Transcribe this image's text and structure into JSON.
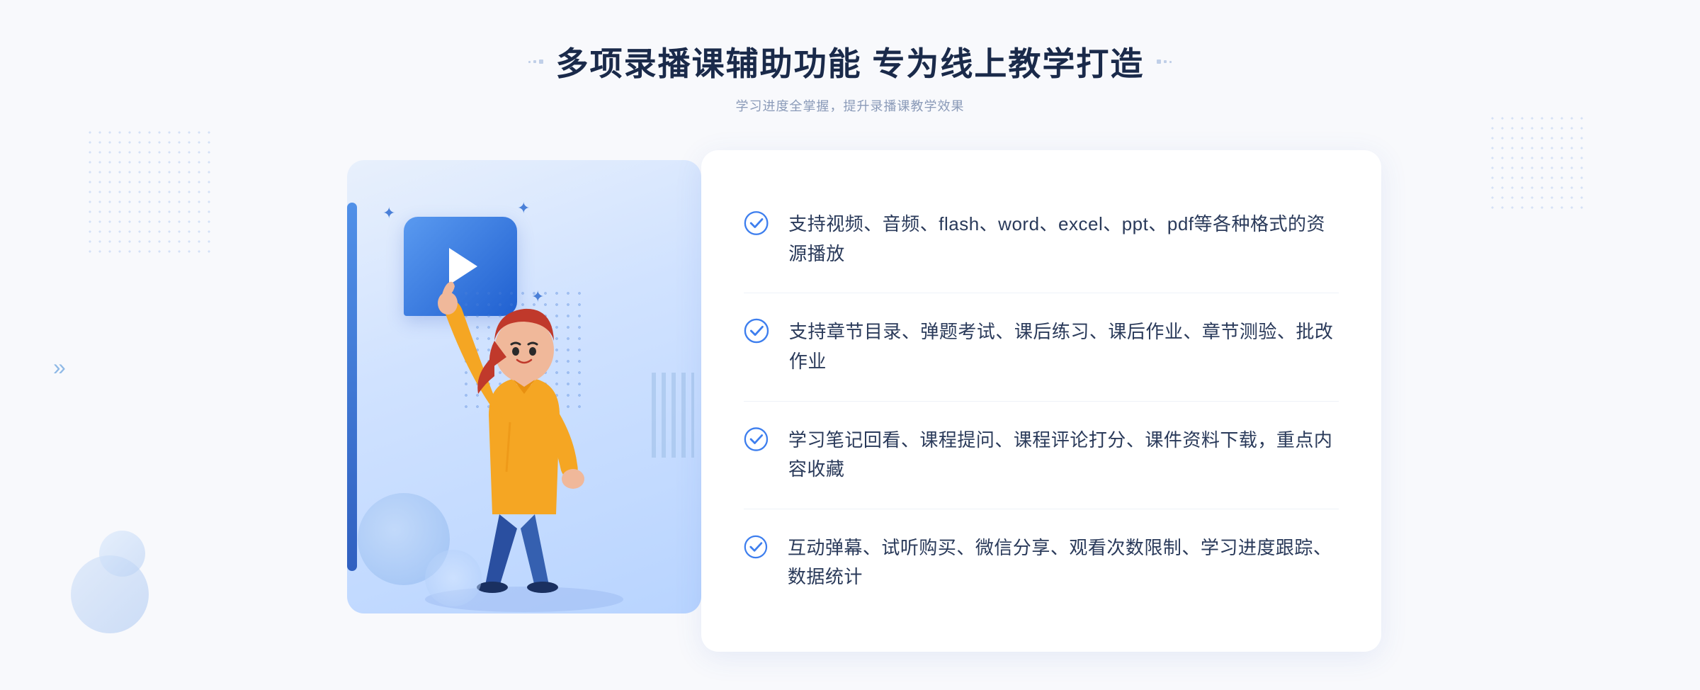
{
  "header": {
    "title": "多项录播课辅助功能 专为线上教学打造",
    "subtitle": "学习进度全掌握，提升录播课教学效果",
    "deco_left": "❋ ❋",
    "deco_right": "❋ ❋"
  },
  "features": [
    {
      "id": 1,
      "text": "支持视频、音频、flash、word、excel、ppt、pdf等各种格式的资源播放"
    },
    {
      "id": 2,
      "text": "支持章节目录、弹题考试、课后练习、课后作业、章节测验、批改作业"
    },
    {
      "id": 3,
      "text": "学习笔记回看、课程提问、课程评论打分、课件资料下载，重点内容收藏"
    },
    {
      "id": 4,
      "text": "互动弹幕、试听购买、微信分享、观看次数限制、学习进度跟踪、数据统计"
    }
  ],
  "colors": {
    "accent": "#3d7eee",
    "title": "#1a2a4a",
    "subtitle": "#8a9ab8",
    "text": "#2a3a5a",
    "check": "#3d7eee",
    "card_bg": "#ffffff",
    "illus_bg_start": "#e8f0fc",
    "illus_bg_end": "#b8d4ff"
  }
}
